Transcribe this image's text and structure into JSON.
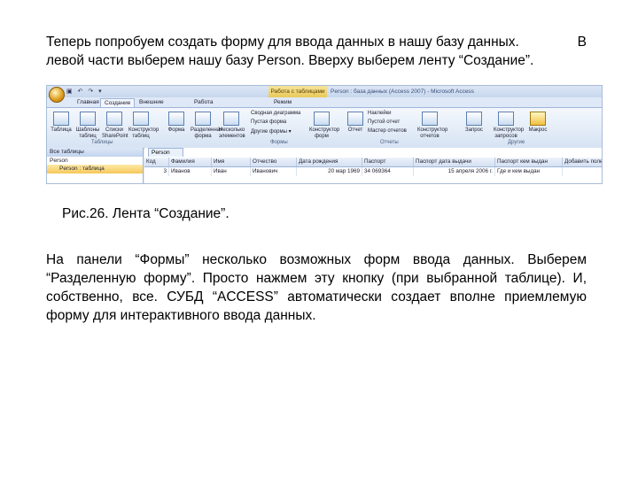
{
  "intro": {
    "line1": "Теперь попробуем создать форму для ввода данных в нашу базу данных.",
    "line1_tail": "В",
    "line2": "левой части выберем нашу базу Person. Вверху выберем ленту “Создание”."
  },
  "screenshot": {
    "quick_access": "▣ ↶ ↷ ▾",
    "context_tab": "Работа с таблицами",
    "window_title": "Person : база данных (Access 2007) - Microsoft Access",
    "tabs": [
      "Главная",
      "Создание",
      "Внешние данные",
      "Работа с базами данных",
      "Режим таблицы"
    ],
    "ribbon_buttons": [
      "Таблица",
      "Шаблоны таблиц",
      "Списки SharePoint",
      "Конструктор таблиц",
      "Форма",
      "Разделенная форма",
      "Несколько элементов",
      "Конструктор форм",
      "Отчет",
      "Конструктор отчетов",
      "Запрос",
      "Конструктор запросов",
      "Макрос"
    ],
    "form_small": [
      "Сводная диаграмма",
      "Пустая форма",
      "Другие формы ▾"
    ],
    "report_small": [
      "Наклейки",
      "Пустой отчет",
      "Мастер отчетов"
    ],
    "groups": [
      "Таблицы",
      "Формы",
      "Отчеты",
      "Другие"
    ],
    "nav_header": "Все таблицы",
    "nav_group": "Person",
    "nav_item": "Person : таблица",
    "grid_tab": "Person",
    "columns": [
      "Код",
      "Фамилия",
      "Имя",
      "Отчество",
      "Дата рождения",
      "Паспорт",
      "Паспорт дата выдачи",
      "Паспорт кем выдан",
      "Добавить поле"
    ],
    "row": [
      "3",
      "Иванов",
      "Иван",
      "Иванович",
      "20 мар 1969",
      "34 069364",
      "15 апреля 2006 г.",
      "Где и кем выдан",
      ""
    ]
  },
  "caption": "Рис.26. Лента “Создание”.",
  "body": {
    "text": "На панели “Формы” несколько возможных форм ввода данных. Выберем “Разделенную форму”. Просто нажмем эту кнопку (при выбранной таблице). И, собственно, все. СУБД “ACCESS” автоматически создает вполне приемлемую форму для интерактивного ввода данных."
  }
}
